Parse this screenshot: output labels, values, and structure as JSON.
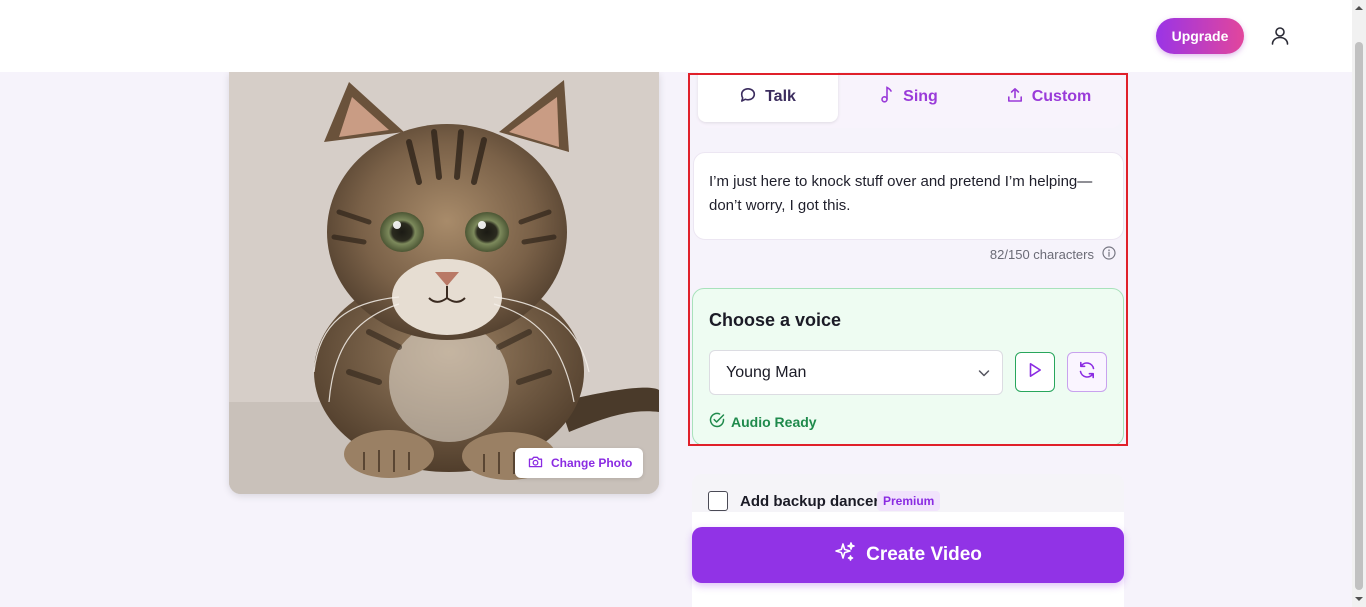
{
  "header": {
    "upgrade_label": "Upgrade",
    "user_icon": "user-icon"
  },
  "photo": {
    "alt": "kitten photo",
    "change_photo_label": "Change Photo",
    "camera_icon": "camera-icon"
  },
  "tabs": [
    {
      "label": "Talk",
      "icon": "speech-bubble-icon",
      "active": true
    },
    {
      "label": "Sing",
      "icon": "music-note-icon",
      "active": false
    },
    {
      "label": "Custom",
      "icon": "upload-icon",
      "active": false
    }
  ],
  "script": {
    "text": "I’m just here to knock stuff over and pretend I’m helping—don’t worry, I got this.",
    "char_count": "82/150 characters",
    "info_icon": "info-icon"
  },
  "voice": {
    "title": "Choose a voice",
    "selected": "Young Man",
    "play_icon": "play-icon",
    "regenerate_icon": "refresh-icon",
    "status": "Audio Ready",
    "status_icon": "check-circle-icon"
  },
  "options": {
    "backup_dancers_label": "Add backup dancers",
    "premium_badge": "Premium",
    "backup_dancers_checked": false
  },
  "cta": {
    "create_label": "Create Video",
    "sparkle_icon": "sparkle-icon"
  },
  "colors": {
    "brand_purple": "#9133e6",
    "upgrade_gradient_start": "#9a34e6",
    "upgrade_gradient_end": "#e2469c",
    "success_green": "#1f8a4c",
    "highlight_red": "#e0202a"
  }
}
